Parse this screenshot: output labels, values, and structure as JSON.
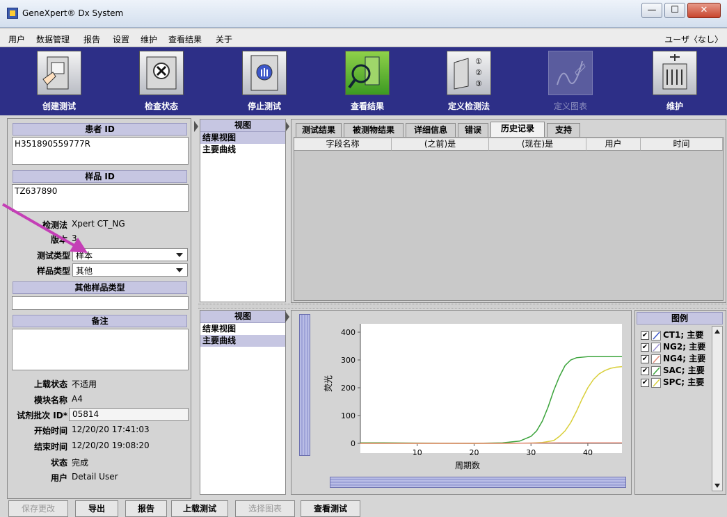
{
  "window": {
    "title": "GeneXpert® Dx System"
  },
  "menu": {
    "items": [
      "用户",
      "数据管理",
      "报告",
      "设置",
      "维护",
      "查看结果",
      "关于"
    ],
    "right_text": "ユーザ〈なし〉"
  },
  "toolbar": {
    "tools": [
      {
        "label": "创建测试",
        "icon": "create-test-icon",
        "state": "normal"
      },
      {
        "label": "检查状态",
        "icon": "check-status-icon",
        "state": "normal"
      },
      {
        "label": "停止测试",
        "icon": "stop-test-icon",
        "state": "normal"
      },
      {
        "label": "查看结果",
        "icon": "view-results-icon",
        "state": "active"
      },
      {
        "label": "定义检测法",
        "icon": "define-assay-icon",
        "state": "normal"
      },
      {
        "label": "定义图表",
        "icon": "define-graph-icon",
        "state": "disabled"
      },
      {
        "label": "维护",
        "icon": "maintenance-icon",
        "state": "normal"
      }
    ]
  },
  "left_panel": {
    "patient_id_header": "患者 ID",
    "patient_id_value": "H351890559777R",
    "sample_id_header": "样品 ID",
    "sample_id_value": "TZ637890",
    "assay_label": "检测法",
    "assay_value": "Xpert CT_NG",
    "version_label": "版本",
    "version_value": "3",
    "test_type_label": "测试类型",
    "test_type_value": "样本",
    "sample_type_label": "样品类型",
    "sample_type_value": "其他",
    "other_sample_type_header": "其他样品类型",
    "other_sample_type_value": "",
    "notes_header": "备注",
    "notes_value": "",
    "upload_status_label": "上载状态",
    "upload_status_value": "不适用",
    "module_name_label": "模块名称",
    "module_name_value": "A4",
    "reagent_lot_label": "试剂批次 ID*",
    "reagent_lot_value": "05814",
    "start_time_label": "开始时间",
    "start_time_value": "12/20/20 17:41:03",
    "end_time_label": "结束时间",
    "end_time_value": "12/20/20 19:08:20",
    "status_label": "状态",
    "status_value": "完成",
    "user_label": "用户",
    "user_value": "Detail User"
  },
  "view_top": {
    "header": "视图",
    "items": [
      "结果视图",
      "主要曲线"
    ],
    "selected": 0
  },
  "view_bottom": {
    "header": "视图",
    "items": [
      "结果视图",
      "主要曲线"
    ],
    "selected": 1
  },
  "tabs": {
    "items": [
      "测试结果",
      "被测物结果",
      "详细信息",
      "错误",
      "历史记录",
      "支持"
    ],
    "active": 4
  },
  "history_table": {
    "columns": [
      "字段名称",
      "(之前)是",
      "(现在)是",
      "用户",
      "时间"
    ],
    "rows": []
  },
  "legend": {
    "header": "图例",
    "items": [
      {
        "label": "CT1; 主要",
        "color": "#3d57c9",
        "checked": true
      },
      {
        "label": "NG2; 主要",
        "color": "#9a8fd0",
        "checked": true
      },
      {
        "label": "NG4; 主要",
        "color": "#e08a78",
        "checked": true
      },
      {
        "label": "SAC; 主要",
        "color": "#3aa33a",
        "checked": true
      },
      {
        "label": "SPC; 主要",
        "color": "#d9cf3a",
        "checked": true
      }
    ]
  },
  "chart_data": {
    "type": "line",
    "title": "",
    "xlabel": "周期数",
    "ylabel": "荧光",
    "xlim": [
      0,
      46
    ],
    "ylim": [
      0,
      410
    ],
    "xticks": [
      10,
      20,
      30,
      40
    ],
    "yticks": [
      0,
      100,
      200,
      300,
      400
    ],
    "series": [
      {
        "name": "SAC; 主要",
        "color": "#3aa33a",
        "x": [
          0,
          4,
          10,
          20,
          25,
          28,
          30,
          31,
          32,
          33,
          34,
          35,
          36,
          37,
          38,
          40,
          43,
          46
        ],
        "y": [
          2,
          2,
          1,
          0,
          2,
          8,
          25,
          45,
          80,
          130,
          190,
          240,
          280,
          300,
          308,
          312,
          312,
          312
        ]
      },
      {
        "name": "SPC; 主要",
        "color": "#d9cf3a",
        "x": [
          0,
          25,
          30,
          32,
          34,
          35,
          36,
          37,
          38,
          39,
          40,
          41,
          42,
          43,
          44,
          45,
          46
        ],
        "y": [
          0,
          0,
          1,
          3,
          10,
          25,
          45,
          75,
          115,
          160,
          200,
          230,
          250,
          262,
          270,
          274,
          276
        ]
      },
      {
        "name": "NG4; 主要",
        "color": "#e08a78",
        "x": [
          0,
          25,
          30,
          35,
          40,
          46
        ],
        "y": [
          0,
          0,
          1,
          2,
          2,
          2
        ]
      }
    ]
  },
  "buttons": [
    {
      "label": "保存更改",
      "enabled": false
    },
    {
      "label": "导出",
      "enabled": true
    },
    {
      "label": "报告",
      "enabled": true
    },
    {
      "label": "上载测试",
      "enabled": true
    },
    {
      "label": "选择图表",
      "enabled": false
    },
    {
      "label": "查看测试",
      "enabled": true
    }
  ]
}
